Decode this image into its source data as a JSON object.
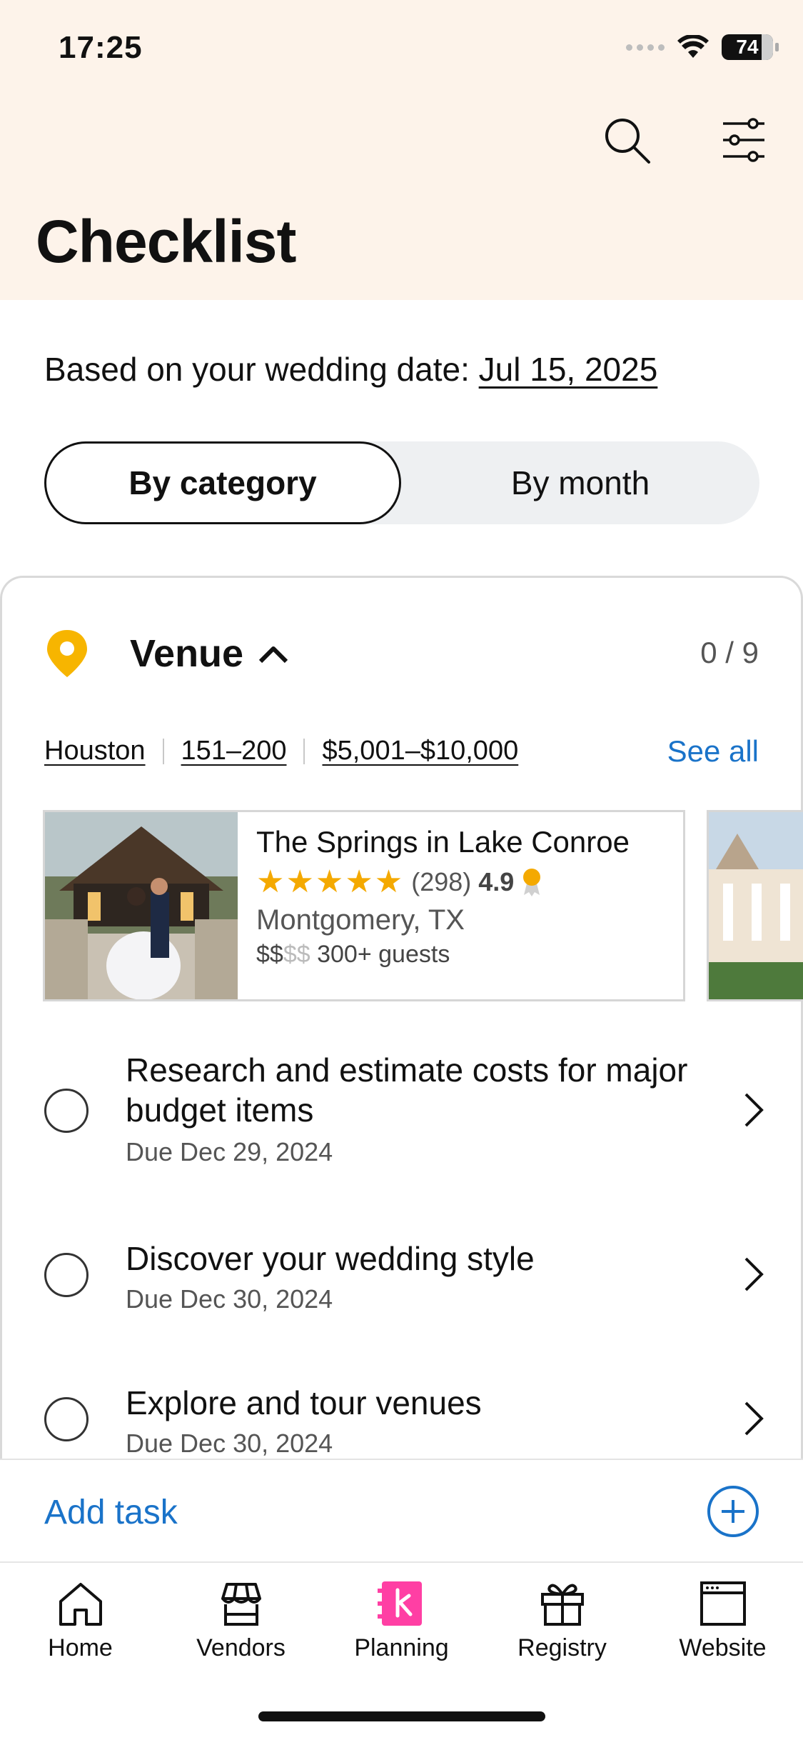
{
  "status_bar": {
    "time": "17:25",
    "battery": "74"
  },
  "header": {
    "title": "Checklist"
  },
  "wedding_date": {
    "prefix": "Based on your wedding date: ",
    "date": "Jul 15, 2025"
  },
  "view_toggle": {
    "by_category": "By category",
    "by_month": "By month",
    "selected": "By category"
  },
  "category": {
    "name": "Venue",
    "count": "0 / 9",
    "filters": [
      "Houston",
      "151–200",
      "$5,001–$10,000"
    ],
    "see_all": "See all",
    "vendor": {
      "name": "The Springs in Lake Conroe",
      "stars": "★★★★★",
      "reviews": "(298)",
      "score": "4.9",
      "location": "Montgomery, TX",
      "price_on": "$$",
      "price_off": "$$",
      "guests": "300+ guests"
    }
  },
  "tasks": [
    {
      "title": "Research and estimate costs for major budget items",
      "due": "Due Dec 29, 2024"
    },
    {
      "title": "Discover your wedding style",
      "due": "Due Dec 30, 2024"
    },
    {
      "title": "Explore and tour venues",
      "due": "Due Dec 30, 2024"
    }
  ],
  "add_task": {
    "label": "Add task"
  },
  "tabs": [
    {
      "label": "Home",
      "icon": "home-icon"
    },
    {
      "label": "Vendors",
      "icon": "storefront-icon"
    },
    {
      "label": "Planning",
      "icon": "planning-icon"
    },
    {
      "label": "Registry",
      "icon": "gift-icon"
    },
    {
      "label": "Website",
      "icon": "browser-window-icon"
    }
  ],
  "colors": {
    "header_bg": "#fdf3ea",
    "link_blue": "#1a73c9",
    "star_gold": "#f4a900",
    "planning_pink": "#ff3fa4"
  }
}
